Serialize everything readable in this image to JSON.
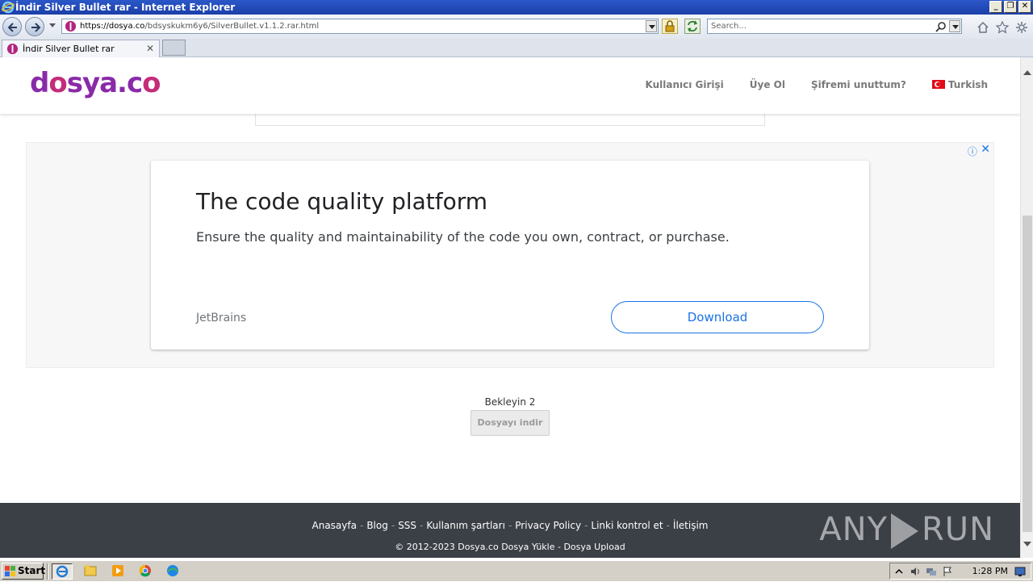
{
  "window": {
    "title": "İndir Silver Bullet rar - Internet Explorer",
    "controls": [
      "_",
      "❐",
      "✕"
    ]
  },
  "address_bar": {
    "url_domain": "https://dosya.co",
    "url_path": "/bdsyskukm6y6/SilverBullet.v1.1.2.rar.html"
  },
  "search": {
    "placeholder": "Search..."
  },
  "tab": {
    "label": "İndir Silver Bullet rar",
    "close": "✕"
  },
  "site": {
    "logo_main": "d",
    "logo_o": "o",
    "logo_rest": "sya.c",
    "logo_o2": "o",
    "nav": {
      "login": "Kullanıcı Girişi",
      "register": "Üye Ol",
      "forgot": "Şifremi unuttum?",
      "language": "Turkish"
    }
  },
  "ad": {
    "info_icon": "ⓘ",
    "close_icon": "✕",
    "title": "The code quality platform",
    "description": "Ensure the quality and maintainability of the code you own, contract, or purchase.",
    "brand": "JetBrains",
    "cta": "Download"
  },
  "download": {
    "wait_label": "Bekleyin 2",
    "button": "Dosyayı indir"
  },
  "footer": {
    "links": [
      "Anasayfa",
      "Blog",
      "SSS",
      "Kullanım şartları",
      "Privacy Policy",
      "Linki kontrol et",
      "İletişim"
    ],
    "separator": "-",
    "copyright": "© 2012-2023 Dosya.co Dosya Yükle - Dosya Upload",
    "watermark_left": "ANY",
    "watermark_right": "RUN"
  },
  "taskbar": {
    "start": "Start",
    "time": "1:28 PM"
  },
  "colors": {
    "logo_purple": "#8a2aa8",
    "logo_pink": "#c42c7a",
    "ad_blue": "#1a73e8",
    "footer_bg": "#3b3f46"
  }
}
